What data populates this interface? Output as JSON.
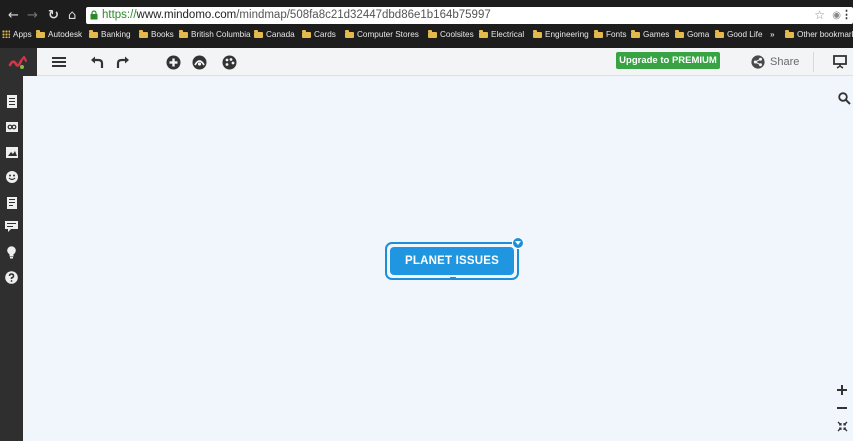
{
  "browser": {
    "url_scheme": "https://",
    "url_host": "www.mindomo.com",
    "url_path": "/mindmap/508fa8c21d32447dbd86e1b164b75997",
    "bookmarks": [
      "Apps",
      "Autodesk",
      "Banking",
      "Books",
      "British Columbia",
      "Canada",
      "Cards",
      "Computer Stores",
      "Coolsites",
      "Electrical",
      "Engineering",
      "Fonts",
      "Games",
      "Goma",
      "Good Life"
    ],
    "overflow_label": "»",
    "other_bookmarks": "Other bookmarks"
  },
  "toolbar": {
    "premium_label": "Upgrade to PREMIUM",
    "share_label": "Share"
  },
  "map": {
    "central_topic": "PLANET ISSUES"
  },
  "colors": {
    "accent": "#2196e0",
    "premium_green": "#37a343",
    "logo_red": "#d9334a",
    "sidebar_bg": "#2f2f2f"
  },
  "icons": {
    "toolbar": [
      "menu-icon",
      "undo-icon",
      "redo-icon",
      "add-topic-icon",
      "theme-icon",
      "palette-icon",
      "share-icon",
      "presentation-icon"
    ],
    "sidebar": [
      "notes-icon",
      "link-icon",
      "image-icon",
      "smiley-icon",
      "task-icon",
      "comments-icon",
      "lightbulb-icon",
      "help-icon"
    ],
    "canvas": [
      "search-icon",
      "zoom-in-icon",
      "zoom-out-icon",
      "fit-icon"
    ]
  }
}
